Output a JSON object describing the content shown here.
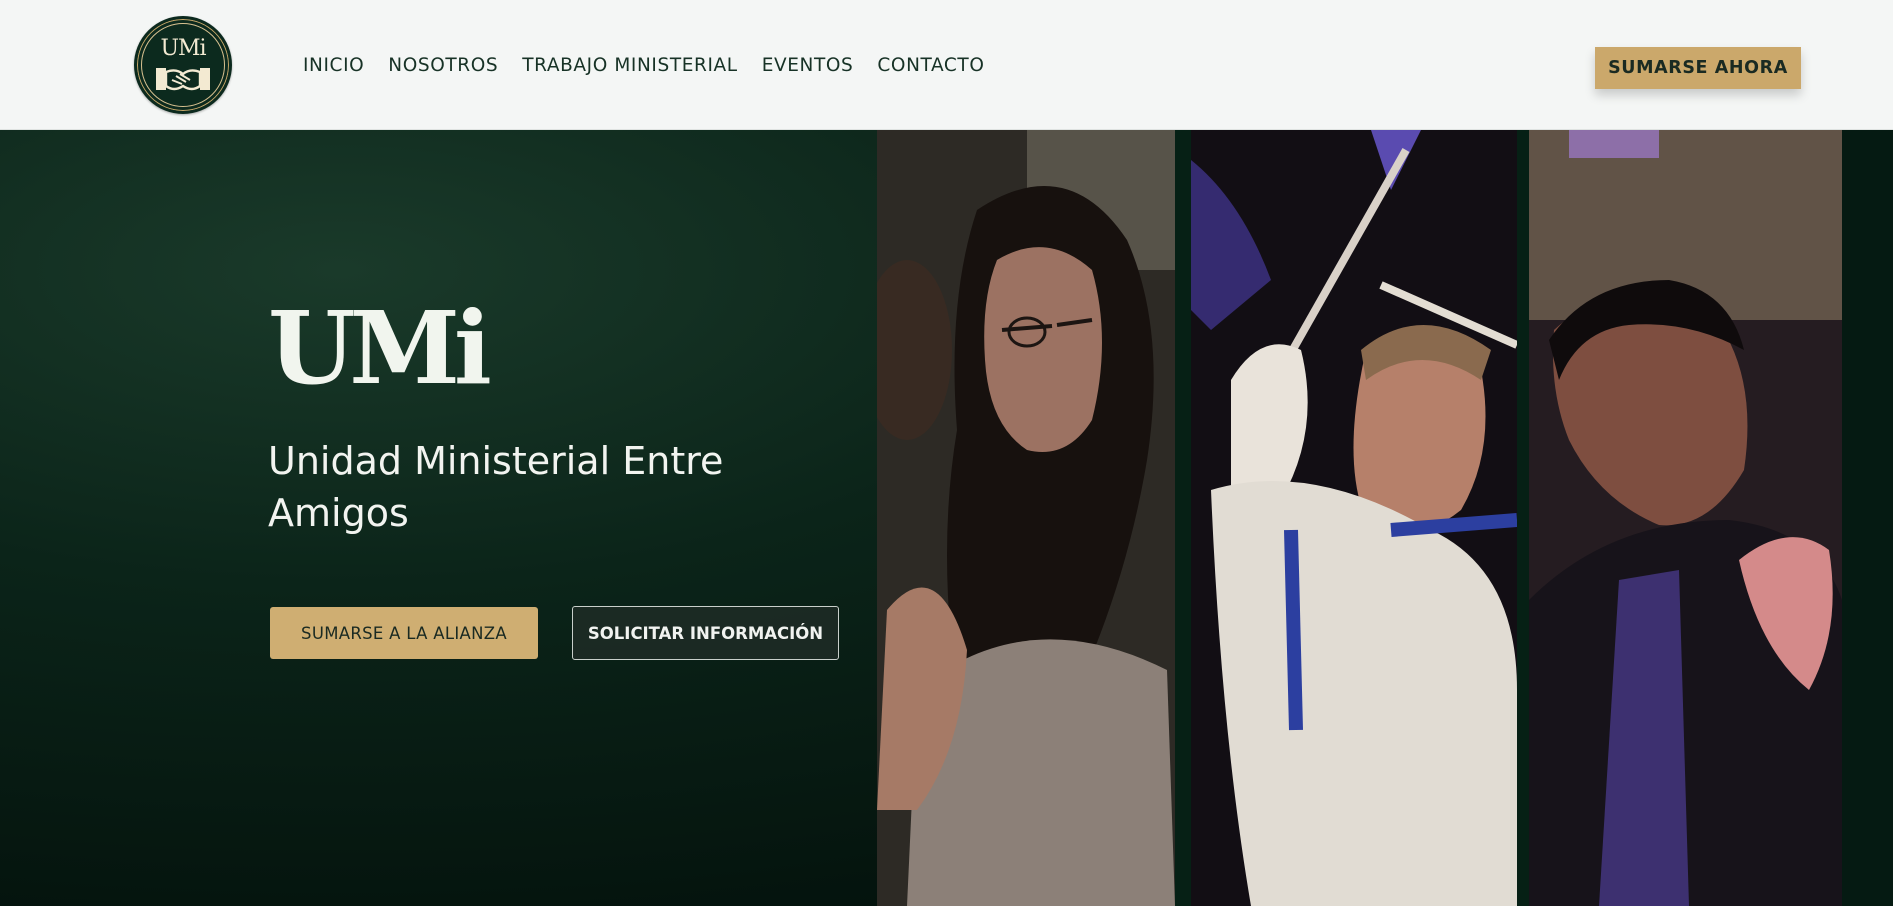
{
  "header": {
    "logo_text": "UMi",
    "nav": [
      {
        "label": "INICIO"
      },
      {
        "label": "NOSOTROS"
      },
      {
        "label": "TRABAJO MINISTERIAL"
      },
      {
        "label": "EVENTOS"
      },
      {
        "label": "CONTACTO"
      }
    ],
    "cta_label": "SUMARSE AHORA"
  },
  "hero": {
    "brand": "UMi",
    "subtitle": "Unidad Ministerial Entre Amigos",
    "primary_button": "SUMARSE A LA ALIANZA",
    "secondary_button": "SOLICITAR INFORMACIÓN",
    "photos": [
      {
        "subject": "woman praying with eyes closed"
      },
      {
        "subject": "boy waving a flag"
      },
      {
        "subject": "man praying with head bowed"
      }
    ]
  },
  "colors": {
    "accent_gold": "#cba86b",
    "hero_dark_green": "#061a13",
    "header_bg": "#f4f6f5",
    "nav_text": "#173226"
  }
}
